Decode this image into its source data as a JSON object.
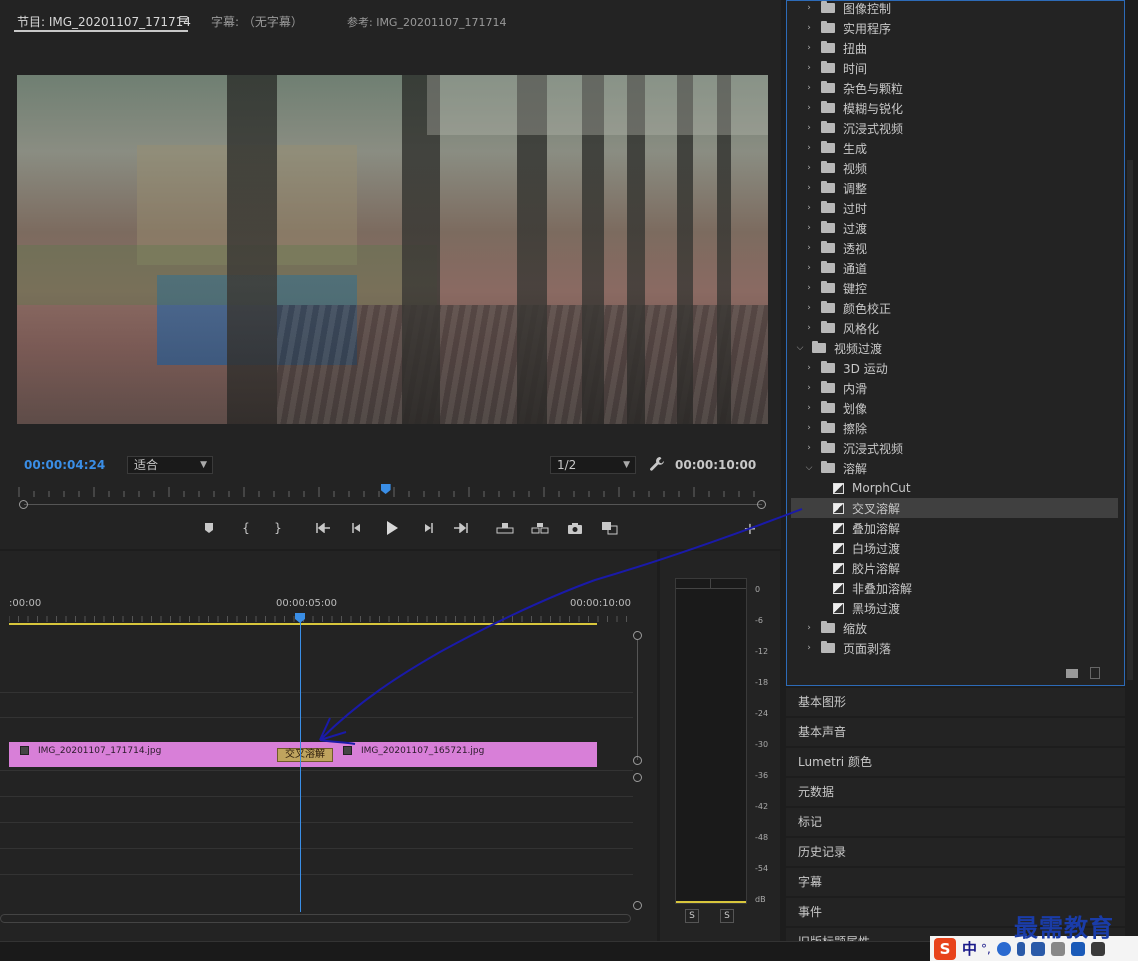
{
  "monitor": {
    "tab_program": "节目: IMG_20201107_171714",
    "tab_menu": "≡",
    "tab_captions": "字幕: （无字幕）",
    "tab_reference": "参考: IMG_20201107_171714",
    "timecode_current": "00:00:04:24",
    "fit": "适合",
    "resolution": "1/2",
    "timecode_duration": "00:00:10:00",
    "playhead_fraction": 0.49
  },
  "transport": {
    "buttons": [
      "mark-in-icon",
      "mark-in-bracket",
      "mark-out-bracket",
      "go-to-in",
      "step-back",
      "play",
      "step-forward",
      "go-to-out",
      "lift",
      "extract",
      "export-frame",
      "insert-overlay",
      "add"
    ]
  },
  "timeline": {
    "time_start": ":00:00",
    "time_mid": "00:00:05:00",
    "time_end": "00:00:10:00",
    "clip_a": "IMG_20201107_171714.jpg",
    "clip_b": "IMG_20201107_165721.jpg",
    "transition": "交叉溶解"
  },
  "meter": {
    "db_labels": [
      "0",
      "-6",
      "-12",
      "-18",
      "-24",
      "-30",
      "-36",
      "-42",
      "-48",
      "-54",
      "dB"
    ],
    "solo": "S"
  },
  "effects": {
    "rows": [
      {
        "label": "图像控制",
        "level": 1,
        "type": "folder",
        "expanded": false
      },
      {
        "label": "实用程序",
        "level": 1,
        "type": "folder",
        "expanded": false
      },
      {
        "label": "扭曲",
        "level": 1,
        "type": "folder",
        "expanded": false
      },
      {
        "label": "时间",
        "level": 1,
        "type": "folder",
        "expanded": false
      },
      {
        "label": "杂色与颗粒",
        "level": 1,
        "type": "folder",
        "expanded": false
      },
      {
        "label": "模糊与锐化",
        "level": 1,
        "type": "folder",
        "expanded": false
      },
      {
        "label": "沉浸式视频",
        "level": 1,
        "type": "folder",
        "expanded": false
      },
      {
        "label": "生成",
        "level": 1,
        "type": "folder",
        "expanded": false
      },
      {
        "label": "视频",
        "level": 1,
        "type": "folder",
        "expanded": false
      },
      {
        "label": "调整",
        "level": 1,
        "type": "folder",
        "expanded": false
      },
      {
        "label": "过时",
        "level": 1,
        "type": "folder",
        "expanded": false
      },
      {
        "label": "过渡",
        "level": 1,
        "type": "folder",
        "expanded": false
      },
      {
        "label": "透视",
        "level": 1,
        "type": "folder",
        "expanded": false
      },
      {
        "label": "通道",
        "level": 1,
        "type": "folder",
        "expanded": false
      },
      {
        "label": "键控",
        "level": 1,
        "type": "folder",
        "expanded": false
      },
      {
        "label": "颜色校正",
        "level": 1,
        "type": "folder",
        "expanded": false
      },
      {
        "label": "风格化",
        "level": 1,
        "type": "folder",
        "expanded": false
      },
      {
        "label": "视频过渡",
        "level": 0,
        "type": "folder",
        "expanded": true
      },
      {
        "label": "3D 运动",
        "level": 1,
        "type": "folder",
        "expanded": false
      },
      {
        "label": "内滑",
        "level": 1,
        "type": "folder",
        "expanded": false
      },
      {
        "label": "划像",
        "level": 1,
        "type": "folder",
        "expanded": false
      },
      {
        "label": "擦除",
        "level": 1,
        "type": "folder",
        "expanded": false
      },
      {
        "label": "沉浸式视频",
        "level": 1,
        "type": "folder",
        "expanded": false
      },
      {
        "label": "溶解",
        "level": 1,
        "type": "folder",
        "expanded": true
      },
      {
        "label": "MorphCut",
        "level": 2,
        "type": "effect"
      },
      {
        "label": "交叉溶解",
        "level": 2,
        "type": "effect",
        "selected": true
      },
      {
        "label": "叠加溶解",
        "level": 2,
        "type": "effect"
      },
      {
        "label": "白场过渡",
        "level": 2,
        "type": "effect"
      },
      {
        "label": "胶片溶解",
        "level": 2,
        "type": "effect"
      },
      {
        "label": "非叠加溶解",
        "level": 2,
        "type": "effect"
      },
      {
        "label": "黑场过渡",
        "level": 2,
        "type": "effect"
      },
      {
        "label": "缩放",
        "level": 1,
        "type": "folder",
        "expanded": false
      },
      {
        "label": "页面剥落",
        "level": 1,
        "type": "folder",
        "expanded": false
      }
    ]
  },
  "panels": [
    "基本图形",
    "基本声音",
    "Lumetri 颜色",
    "元数据",
    "标记",
    "历史记录",
    "字幕",
    "事件",
    "旧版标题属性"
  ],
  "ime": {
    "logo": "S",
    "lang": "中",
    "punct": "°,"
  },
  "watermark": "最需教育",
  "colors": {
    "accent": "#3a8ee6",
    "clip": "#d87fd8",
    "transition": "#bfa45e",
    "arrow": "#1a1aa8",
    "selection_border": "#2d6bb8"
  }
}
